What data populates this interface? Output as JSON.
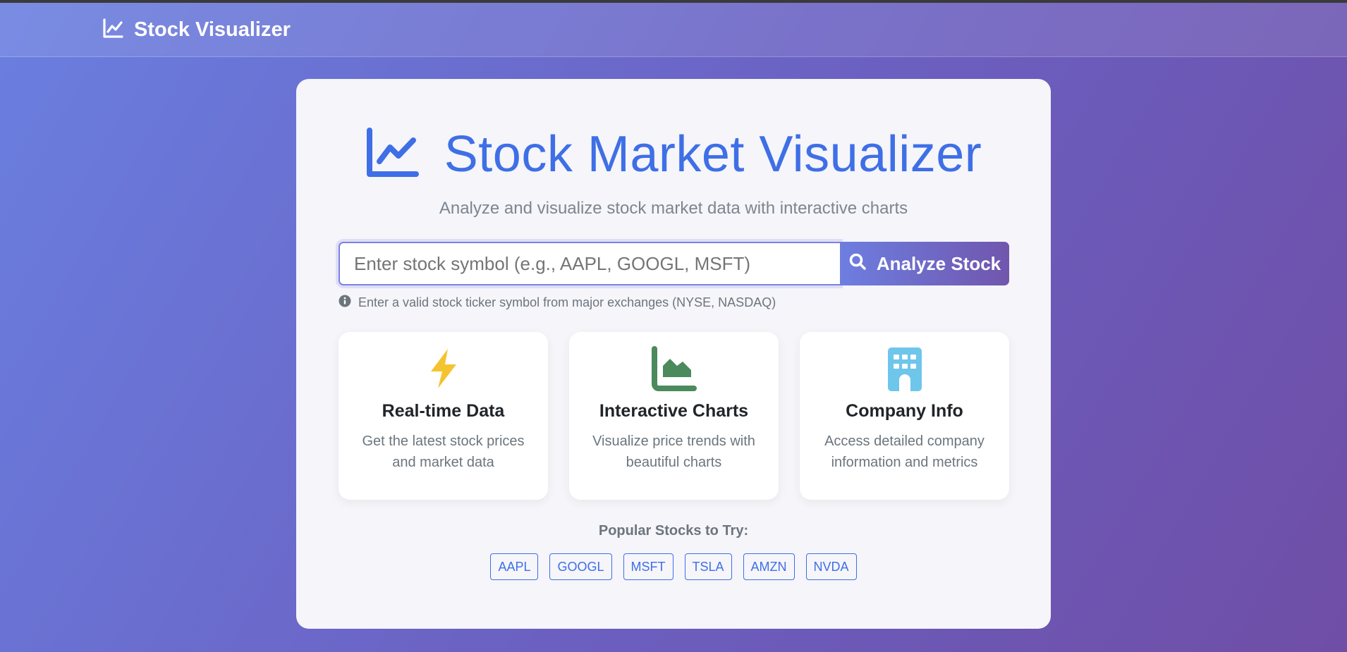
{
  "navbar": {
    "brand": "Stock Visualizer",
    "brand_icon": "chart-line-icon"
  },
  "hero": {
    "title": "Stock Market Visualizer",
    "icon": "chart-line-icon",
    "subtitle": "Analyze and visualize stock market data with interactive charts"
  },
  "search": {
    "placeholder": "Enter stock symbol (e.g., AAPL, GOOGL, MSFT)",
    "value": "",
    "button_label": "Analyze Stock",
    "button_icon": "search-icon",
    "hint": "Enter a valid stock ticker symbol from major exchanges (NYSE, NASDAQ)",
    "hint_icon": "info-circle-icon"
  },
  "features": [
    {
      "icon": "bolt-icon",
      "title": "Real-time Data",
      "description": "Get the latest stock prices and market data"
    },
    {
      "icon": "area-chart-icon",
      "title": "Interactive Charts",
      "description": "Visualize price trends with beautiful charts"
    },
    {
      "icon": "building-icon",
      "title": "Company Info",
      "description": "Access detailed company information and metrics"
    }
  ],
  "popular": {
    "label": "Popular Stocks to Try:",
    "symbols": [
      "AAPL",
      "GOOGL",
      "MSFT",
      "TSLA",
      "AMZN",
      "NVDA"
    ]
  },
  "colors": {
    "accent": "#3f6fe6",
    "bolt": "#f4c430",
    "chart_green": "#4a8a5c",
    "building_blue": "#6ec6ea"
  }
}
